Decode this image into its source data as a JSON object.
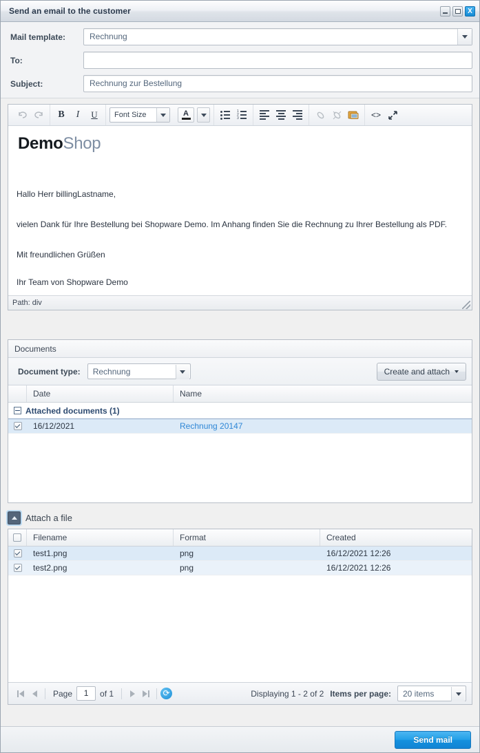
{
  "window": {
    "title": "Send an email to the customer",
    "controls": {
      "minimize": "minimize-button",
      "maximize": "maximize-button",
      "close": "X"
    }
  },
  "form": {
    "mail_template": {
      "label": "Mail template:",
      "value": "Rechnung"
    },
    "to": {
      "label": "To:",
      "value": "",
      "placeholder": ""
    },
    "subject": {
      "label": "Subject:",
      "value": "Rechnung zur Bestellung"
    }
  },
  "editor": {
    "toolbar": {
      "undo": "undo-icon",
      "redo": "redo-icon",
      "bold": "B",
      "italic": "I",
      "underline": "U",
      "font_size": "Font Size",
      "text_color": "A",
      "bullet_list": "bullet-list-icon",
      "numbered_list": "numbered-list-icon",
      "align_left": "align-left-icon",
      "align_center": "align-center-icon",
      "align_right": "align-right-icon",
      "link": "link-icon",
      "unlink": "unlink-icon",
      "image": "image-icon",
      "source_code": "<>",
      "fullscreen": "fullscreen-icon"
    },
    "logo": {
      "part1": "Demo",
      "part2": "Shop"
    },
    "lines": [
      "Hallo Herr billingLastname,",
      "vielen Dank für Ihre Bestellung bei Shopware Demo. Im Anhang finden Sie die Rechnung zu Ihrer Bestellung als PDF.",
      "Mit freundlichen Grüßen",
      "Ihr Team von Shopware Demo"
    ],
    "status_path": "Path: div"
  },
  "documents": {
    "panel_title": "Documents",
    "doc_type_label": "Document type:",
    "doc_type_value": "Rechnung",
    "create_attach_label": "Create and attach",
    "columns": [
      "Date",
      "Name"
    ],
    "group_label": "Attached documents (1)",
    "rows": [
      {
        "checked": true,
        "date": "16/12/2021",
        "name": "Rechnung 20147"
      }
    ]
  },
  "attach": {
    "button_label": "Attach a file",
    "columns": [
      "Filename",
      "Format",
      "Created"
    ],
    "rows": [
      {
        "checked": true,
        "filename": "test1.png",
        "format": "png",
        "created": "16/12/2021 12:26"
      },
      {
        "checked": true,
        "filename": "test2.png",
        "format": "png",
        "created": "16/12/2021 12:26"
      }
    ]
  },
  "pager": {
    "page_label": "Page",
    "page_value": "1",
    "of_label": "of 1",
    "displaying": "Displaying 1 - 2 of 2",
    "items_per_page_label": "Items per page:",
    "items_per_page_value": "20 items"
  },
  "footer": {
    "send_label": "Send mail"
  },
  "colors": {
    "accent": "#1a8fd6",
    "link": "#2f87d6",
    "title_text": "#2b3a4d",
    "selected_row": "#dceaf7"
  }
}
